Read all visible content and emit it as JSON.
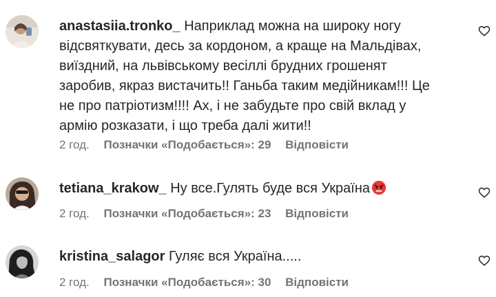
{
  "comments": [
    {
      "username": "anastasiia.tronko_",
      "text": "Наприклад можна на широку ногу відсвяткувати, десь за кордоном, а краще на Мальдівах, виїздний, на львівському весіллі брудних грошенят заробив, якраз вистачить!! Ганьба таким медійникам!!! Це не про патріотизм!!!! Ах, і не забудьте про свій вклад у армію розказати, і що треба далі жити!!",
      "time": "2 год.",
      "likes": "Позначки «Подобається»: 29",
      "reply": "Відповісти"
    },
    {
      "username": "tetiana_krakow_",
      "text": "Ну все.Гулять буде вся Україна",
      "emoji": "angry-face-emoji",
      "time": "2 год.",
      "likes": "Позначки «Подобається»: 23",
      "reply": "Відповісти"
    },
    {
      "username": "kristina_salagor",
      "text": "Гуляє вся Україна.....",
      "time": "2 год.",
      "likes": "Позначки «Подобається»: 30",
      "reply": "Відповісти"
    }
  ],
  "icons": {
    "like": "heart-outline-icon"
  },
  "colors": {
    "text": "#262626",
    "muted": "#737373",
    "emoji_red": "#e53935"
  }
}
